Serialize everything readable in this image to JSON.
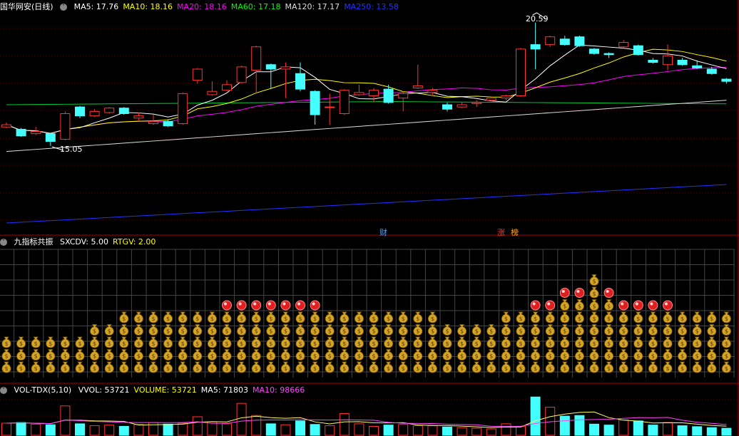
{
  "main_panel": {
    "title": "国华网安(日线)",
    "ma_labels": [
      {
        "text": "MA5: 17.76",
        "color": "#ffffff"
      },
      {
        "text": "MA10: 18.16",
        "color": "#ffff00"
      },
      {
        "text": "MA20: 18.16",
        "color": "#ff00ff"
      },
      {
        "text": "MA60: 17.18",
        "color": "#00ff00"
      },
      {
        "text": "MA120: 17.17",
        "color": "#dddddd"
      },
      {
        "text": "MA250: 13.58",
        "color": "#2233ff"
      }
    ],
    "high_label": "20.59",
    "low_label": "15.05",
    "event_tags": [
      {
        "text": "财",
        "color": "#4aa0ff"
      },
      {
        "text": "涨",
        "color": "#ff3333"
      },
      {
        "text": "榜",
        "color": "#ffaa00"
      }
    ]
  },
  "indicator_panel": {
    "title": "九指标共振",
    "params": [
      {
        "text": "SXCDV: 5.00",
        "color": "#ffffff"
      },
      {
        "text": "RTGV: 2.00",
        "color": "#ffff00"
      }
    ],
    "bag_icon": "money-bag-icon",
    "ball_icon": "red-ball-icon",
    "stacks": [
      3,
      3,
      3,
      3,
      3,
      3,
      4,
      4,
      5,
      5,
      5,
      5,
      5,
      5,
      5,
      6,
      6,
      6,
      6,
      6,
      6,
      6,
      5,
      5,
      5,
      5,
      5,
      5,
      5,
      5,
      4,
      4,
      4,
      4,
      5,
      5,
      6,
      6,
      7,
      7,
      8,
      7,
      6,
      6,
      6,
      6,
      5,
      5,
      5,
      5
    ]
  },
  "volume_panel": {
    "title": "VOL-TDX(5,10)",
    "labels": [
      {
        "text": "VVOL: 53721",
        "color": "#ffffff"
      },
      {
        "text": "VOLUME: 53721",
        "color": "#ffff00"
      },
      {
        "text": "MA5: 71803",
        "color": "#ffffff"
      },
      {
        "text": "MA10: 98666",
        "color": "#ff44ff"
      }
    ]
  },
  "candles": [
    {
      "o": 15.9,
      "c": 16.0,
      "h": 16.1,
      "l": 15.85
    },
    {
      "o": 15.8,
      "c": 15.5,
      "h": 15.85,
      "l": 15.45
    },
    {
      "o": 15.6,
      "c": 15.7,
      "h": 15.9,
      "l": 15.55
    },
    {
      "o": 15.6,
      "c": 15.25,
      "h": 15.65,
      "l": 15.05
    },
    {
      "o": 15.35,
      "c": 16.5,
      "h": 16.6,
      "l": 15.3
    },
    {
      "o": 16.8,
      "c": 16.4,
      "h": 16.85,
      "l": 16.3
    },
    {
      "o": 16.4,
      "c": 16.6,
      "h": 16.7,
      "l": 16.35
    },
    {
      "o": 16.55,
      "c": 16.75,
      "h": 16.8,
      "l": 16.5
    },
    {
      "o": 16.75,
      "c": 16.5,
      "h": 16.8,
      "l": 16.45
    },
    {
      "o": 16.3,
      "c": 16.4,
      "h": 16.55,
      "l": 16.2
    },
    {
      "o": 16.05,
      "c": 16.15,
      "h": 16.45,
      "l": 16.0
    },
    {
      "o": 16.15,
      "c": 15.95,
      "h": 16.25,
      "l": 15.9
    },
    {
      "o": 16.05,
      "c": 17.4,
      "h": 17.45,
      "l": 16.0
    },
    {
      "o": 18.0,
      "c": 18.5,
      "h": 18.55,
      "l": 17.85
    },
    {
      "o": 17.35,
      "c": 17.5,
      "h": 17.95,
      "l": 17.3
    },
    {
      "o": 17.55,
      "c": 17.8,
      "h": 18.0,
      "l": 17.5
    },
    {
      "o": 17.9,
      "c": 18.6,
      "h": 18.65,
      "l": 17.85
    },
    {
      "o": 18.45,
      "c": 19.5,
      "h": 19.55,
      "l": 17.4
    },
    {
      "o": 18.7,
      "c": 18.5,
      "h": 18.75,
      "l": 17.6
    },
    {
      "o": 18.5,
      "c": 18.6,
      "h": 18.8,
      "l": 17.2
    },
    {
      "o": 18.3,
      "c": 17.6,
      "h": 18.8,
      "l": 17.5
    },
    {
      "o": 17.5,
      "c": 16.45,
      "h": 17.55,
      "l": 16.0
    },
    {
      "o": 16.8,
      "c": 16.8,
      "h": 17.4,
      "l": 16.0
    },
    {
      "o": 16.5,
      "c": 17.55,
      "h": 17.6,
      "l": 16.45
    },
    {
      "o": 17.35,
      "c": 17.45,
      "h": 17.8,
      "l": 17.3
    },
    {
      "o": 17.3,
      "c": 17.55,
      "h": 17.65,
      "l": 17.0
    },
    {
      "o": 17.6,
      "c": 17.0,
      "h": 17.8,
      "l": 16.95
    },
    {
      "o": 17.2,
      "c": 17.4,
      "h": 17.5,
      "l": 16.6
    },
    {
      "o": 17.65,
      "c": 17.75,
      "h": 18.7,
      "l": 17.6
    },
    {
      "o": 17.45,
      "c": 17.55,
      "h": 17.65,
      "l": 17.35
    },
    {
      "o": 16.9,
      "c": 16.7,
      "h": 17.0,
      "l": 16.6
    },
    {
      "o": 16.8,
      "c": 16.9,
      "h": 17.0,
      "l": 16.75
    },
    {
      "o": 16.95,
      "c": 17.0,
      "h": 17.1,
      "l": 16.8
    },
    {
      "o": 17.1,
      "c": 17.2,
      "h": 17.25,
      "l": 17.05
    },
    {
      "o": 17.2,
      "c": 17.3,
      "h": 17.35,
      "l": 17.1
    },
    {
      "o": 17.3,
      "c": 19.4,
      "h": 19.45,
      "l": 17.25
    },
    {
      "o": 19.6,
      "c": 19.4,
      "h": 20.59,
      "l": 18.5
    },
    {
      "o": 19.6,
      "c": 19.95,
      "h": 20.0,
      "l": 19.5
    },
    {
      "o": 19.85,
      "c": 19.6,
      "h": 20.0,
      "l": 19.55
    },
    {
      "o": 19.95,
      "c": 19.55,
      "h": 20.0,
      "l": 19.5
    },
    {
      "o": 19.4,
      "c": 19.2,
      "h": 19.45,
      "l": 19.15
    },
    {
      "o": 19.2,
      "c": 19.15,
      "h": 19.25,
      "l": 19.0
    },
    {
      "o": 19.5,
      "c": 19.7,
      "h": 19.8,
      "l": 19.45
    },
    {
      "o": 19.55,
      "c": 19.15,
      "h": 19.6,
      "l": 19.1
    },
    {
      "o": 18.9,
      "c": 18.8,
      "h": 19.0,
      "l": 18.75
    },
    {
      "o": 18.7,
      "c": 19.1,
      "h": 19.6,
      "l": 18.45
    },
    {
      "o": 18.9,
      "c": 18.7,
      "h": 19.0,
      "l": 18.65
    },
    {
      "o": 18.65,
      "c": 18.55,
      "h": 18.9,
      "l": 18.5
    },
    {
      "o": 18.5,
      "c": 18.3,
      "h": 18.6,
      "l": 18.25
    },
    {
      "o": 18.05,
      "c": 17.95,
      "h": 18.1,
      "l": 17.85
    }
  ],
  "volumes": [
    38,
    40,
    35,
    33,
    92,
    36,
    30,
    32,
    28,
    34,
    40,
    35,
    38,
    58,
    42,
    36,
    100,
    62,
    36,
    33,
    45,
    34,
    30,
    68,
    36,
    28,
    32,
    34,
    30,
    30,
    26,
    24,
    22,
    20,
    36,
    28,
    120,
    88,
    60,
    62,
    35,
    32,
    48,
    45,
    32,
    40,
    30,
    27,
    24,
    22
  ]
}
